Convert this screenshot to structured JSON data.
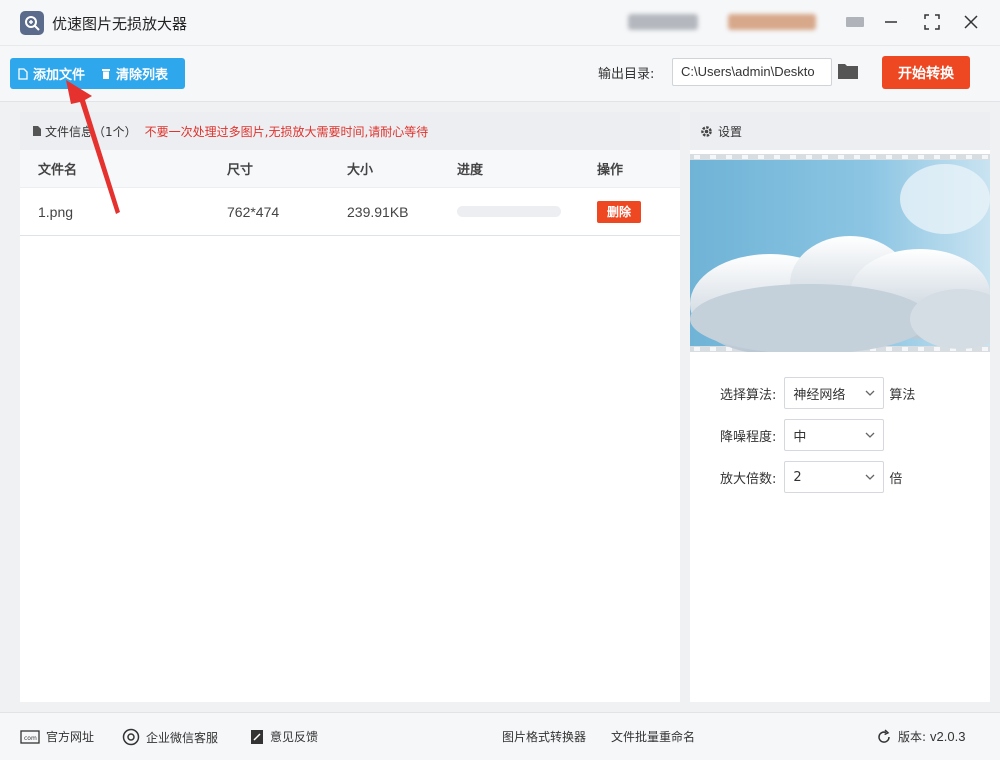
{
  "window": {
    "title": "优速图片无损放大器",
    "blurred_account_colors": [
      "#9aa0a8",
      "#c98a66"
    ]
  },
  "toolbar": {
    "add_file_label": "添加文件",
    "clear_list_label": "清除列表",
    "output_dir_label": "输出目录:",
    "output_dir_value": "C:\\Users\\admin\\Deskto",
    "start_label": "开始转换",
    "accent_color": "#2fa7ed",
    "start_color": "#ee4822"
  },
  "file_panel": {
    "header_title": "文件信息（1个）",
    "warning": "不要一次处理过多图片,无损放大需要时间,请耐心等待",
    "columns": [
      "文件名",
      "尺寸",
      "大小",
      "进度",
      "操作"
    ],
    "rows": [
      {
        "name": "1.png",
        "size": "762*474",
        "filesize": "239.91KB",
        "progress": 0,
        "action": "删除"
      }
    ]
  },
  "settings": {
    "header_title": "设置",
    "algorithm_label": "选择算法:",
    "algorithm_value": "神经网络",
    "algorithm_suffix": "算法",
    "denoise_label": "降噪程度:",
    "denoise_value": "中",
    "scale_label": "放大倍数:",
    "scale_value": "2",
    "scale_suffix": "倍"
  },
  "footer": {
    "website": "官方网址",
    "wechat_service": "企业微信客服",
    "feedback": "意见反馈",
    "format_converter": "图片格式转换器",
    "batch_rename": "文件批量重命名",
    "version_label": "版本:",
    "version_value": "v2.0.3"
  },
  "icons": [
    "app-logo-icon",
    "minimize-icon",
    "maximize-icon",
    "close-icon",
    "file-icon",
    "trash-icon",
    "folder-icon",
    "gear-icon",
    "chevron-down-icon",
    "website-icon",
    "chat-icon",
    "feedback-icon",
    "refresh-icon"
  ]
}
